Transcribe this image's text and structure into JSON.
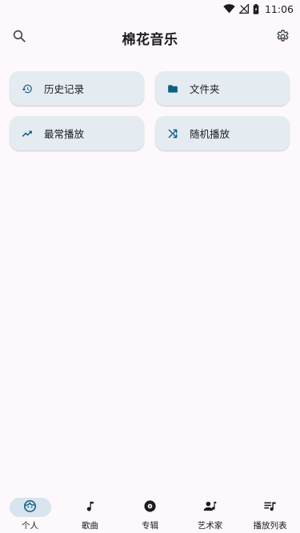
{
  "status": {
    "time": "11:06"
  },
  "app": {
    "title": "棉花音乐"
  },
  "icons": {
    "search": "search-icon",
    "settings": "gear-icon"
  },
  "colors": {
    "accent": "#0e5f82",
    "card_bg": "#e4ebf1",
    "nav_active_bg": "#d8e4ee"
  },
  "cards": [
    {
      "label": "历史记录",
      "icon": "history-icon"
    },
    {
      "label": "文件夹",
      "icon": "folder-icon"
    },
    {
      "label": "最常播放",
      "icon": "trending-up-icon"
    },
    {
      "label": "随机播放",
      "icon": "shuffle-icon"
    }
  ],
  "nav": [
    {
      "label": "个人",
      "icon": "face-icon",
      "active": true
    },
    {
      "label": "歌曲",
      "icon": "music-note-icon",
      "active": false
    },
    {
      "label": "专辑",
      "icon": "album-icon",
      "active": false
    },
    {
      "label": "艺术家",
      "icon": "artist-icon",
      "active": false
    },
    {
      "label": "播放列表",
      "icon": "playlist-icon",
      "active": false
    }
  ]
}
